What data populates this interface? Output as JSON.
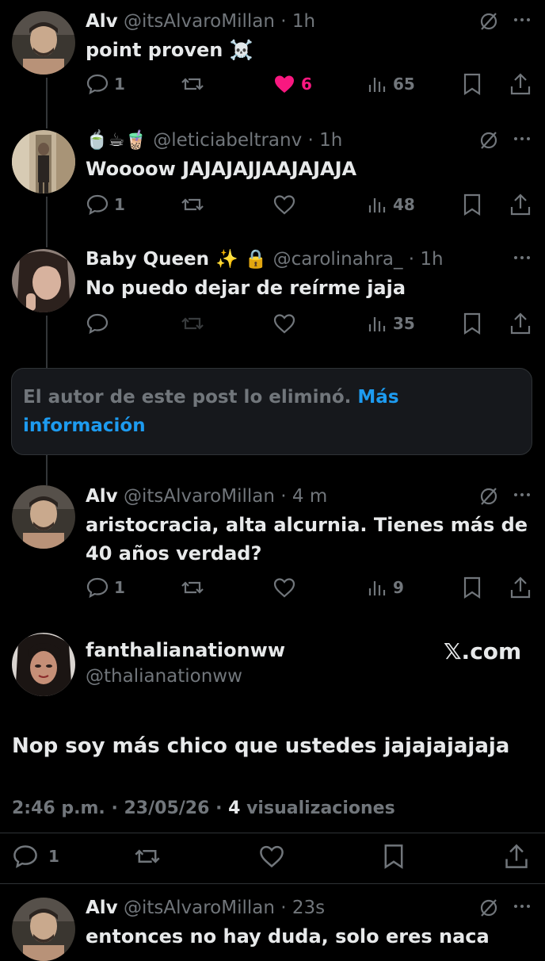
{
  "replies": [
    {
      "name": "Alv",
      "handle": "@itsAlvaroMillan",
      "time": "1h",
      "text": "point proven ☠️",
      "replies": "1",
      "likes": "6",
      "views": "65",
      "liked": true
    },
    {
      "name": "🍵☕🧋",
      "handle": "@leticiabeltranv",
      "time": "1h",
      "text": "Woooow JAJAJAJJAAJAJAJA",
      "replies": "1",
      "likes": "",
      "views": "48",
      "liked": false
    },
    {
      "name": "Baby Queen ✨ 🔒",
      "handle": "@carolinahra_",
      "time": "1h",
      "text": "No puedo dejar de reírme jaja",
      "replies": "",
      "likes": "",
      "views": "35",
      "liked": false
    }
  ],
  "deleted_notice": {
    "text": "El autor de este post lo eliminó.",
    "link": "Más información"
  },
  "reply4": {
    "name": "Alv",
    "handle": "@itsAlvaroMillan",
    "time": "4 m",
    "text_line1": "aristocracia, alta alcurnia. Tienes más de",
    "text_line2": "40 años verdad?",
    "replies": "1",
    "views": "9"
  },
  "main_post": {
    "name": "fanthalianationww",
    "handle": "@thalianationww",
    "site": "𝕏.com",
    "text": "Nop soy más chico que ustedes jajajajajaja",
    "time": "2:46 p.m.",
    "date": "23/05/26",
    "views_count": "4",
    "views_label": "visualizaciones",
    "replies": "1"
  },
  "reply5": {
    "name": "Alv",
    "handle": "@itsAlvaroMillan",
    "time": "23s",
    "text": "entonces no hay duda, solo eres naca"
  },
  "colors": {
    "background": "#000000",
    "text": "#e7e9ea",
    "muted": "#71767b",
    "link": "#1d9bf0",
    "like": "#f91880"
  }
}
